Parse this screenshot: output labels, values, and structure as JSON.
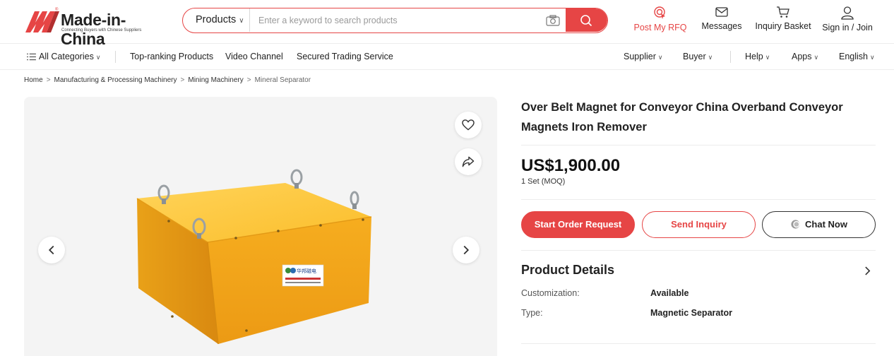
{
  "header": {
    "logo": {
      "name": "Made-in-China",
      "tagline": "Connecting Buyers with Chinese Suppliers",
      "registered_mark": "®",
      "brand_color": "#e64545"
    },
    "search": {
      "category": "Products",
      "placeholder": "Enter a keyword to search products",
      "value": ""
    },
    "nav": {
      "post_rfq": "Post My RFQ",
      "messages": "Messages",
      "inquiry_basket": "Inquiry Basket",
      "sign_in": "Sign in / Join"
    }
  },
  "subnav": {
    "all_categories": "All Categories",
    "links": [
      "Top-ranking Products",
      "Video Channel",
      "Secured Trading Service"
    ],
    "right": {
      "supplier": "Supplier",
      "buyer": "Buyer",
      "help": "Help",
      "apps": "Apps",
      "language": "English"
    }
  },
  "breadcrumb": {
    "items": [
      "Home",
      "Manufacturing & Processing Machinery",
      "Mining Machinery"
    ],
    "separator": ">",
    "current": "Mineral Separator"
  },
  "product": {
    "title": "Over Belt Magnet for Conveyor China Overband Conveyor Magnets Iron Remover",
    "price": "US$1,900.00",
    "moq": "1 Set (MOQ)",
    "buttons": {
      "order": "Start Order Request",
      "inquiry": "Send Inquiry",
      "chat": "Chat Now"
    },
    "details": {
      "heading": "Product Details",
      "specs": [
        {
          "label": "Customization:",
          "value": "Available"
        },
        {
          "label": "Type:",
          "value": "Magnetic Separator"
        }
      ]
    },
    "image_label": {
      "brand": "华邦磁电"
    }
  },
  "icons": {
    "camera": "camera-icon",
    "search": "search-icon",
    "rfq": "target-icon",
    "messages": "envelope-icon",
    "basket": "cart-icon",
    "user": "user-icon",
    "menu": "menu-icon",
    "favorite": "heart-icon",
    "share": "share-icon",
    "prev": "chevron-left-icon",
    "next": "chevron-right-icon"
  },
  "colors": {
    "accent": "#e64545",
    "product_yellow": "#f7b526"
  }
}
